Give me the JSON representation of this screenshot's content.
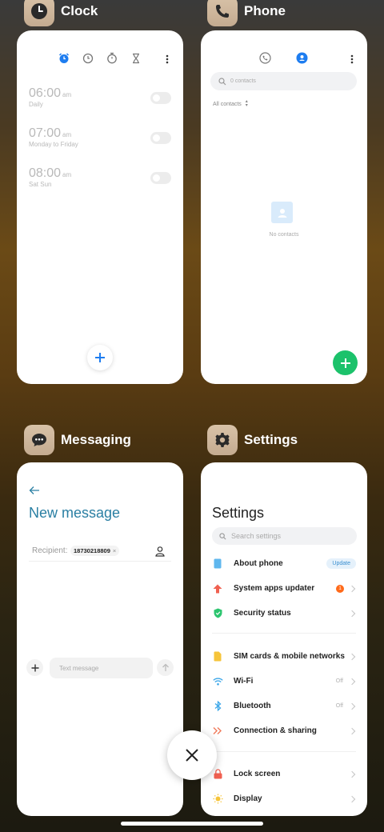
{
  "apps": {
    "clock": {
      "name": "Clock",
      "alarms": [
        {
          "time": "06:00",
          "ampm": "am",
          "repeat": "Daily",
          "enabled": false
        },
        {
          "time": "07:00",
          "ampm": "am",
          "repeat": "Monday to Friday",
          "enabled": false
        },
        {
          "time": "08:00",
          "ampm": "am",
          "repeat": "Sat Sun",
          "enabled": false
        }
      ],
      "icons": [
        "alarm-icon",
        "clock-icon",
        "stopwatch-icon",
        "timer-icon",
        "more-icon",
        "add-icon"
      ]
    },
    "phone": {
      "name": "Phone",
      "search_placeholder": "0 contacts",
      "filter_label": "All contacts",
      "empty_text": "No contacts",
      "icons": [
        "phone-icon",
        "contacts-icon",
        "search-icon",
        "more-icon",
        "add-icon"
      ]
    },
    "messaging": {
      "name": "Messaging",
      "title": "New message",
      "recipient_label": "Recipient:",
      "recipient_chip": "18730218809",
      "chip_remove": "×",
      "input_placeholder": "Text message",
      "icons": [
        "back-arrow-icon",
        "contact-picker-icon",
        "add-icon",
        "send-icon"
      ]
    },
    "settings": {
      "name": "Settings",
      "title": "Settings",
      "search_placeholder": "Search settings",
      "about_phone": {
        "label": "About phone",
        "badge": "Update"
      },
      "system_updater": {
        "label": "System apps updater",
        "badge_count": "1"
      },
      "security_status": {
        "label": "Security status"
      },
      "sim_cards": {
        "label": "SIM cards & mobile networks"
      },
      "wifi": {
        "label": "Wi-Fi",
        "value": "Off"
      },
      "bluetooth": {
        "label": "Bluetooth",
        "value": "Off"
      },
      "connection_sharing": {
        "label": "Connection & sharing"
      },
      "lock_screen": {
        "label": "Lock screen"
      },
      "display": {
        "label": "Display"
      }
    }
  },
  "colors": {
    "accent_blue": "#1e7df0",
    "messaging_teal": "#2a7fa3",
    "phone_green": "#1cc26b",
    "settings_update_badge": "#e5f1fb",
    "notification_orange": "#ff6a1a"
  }
}
